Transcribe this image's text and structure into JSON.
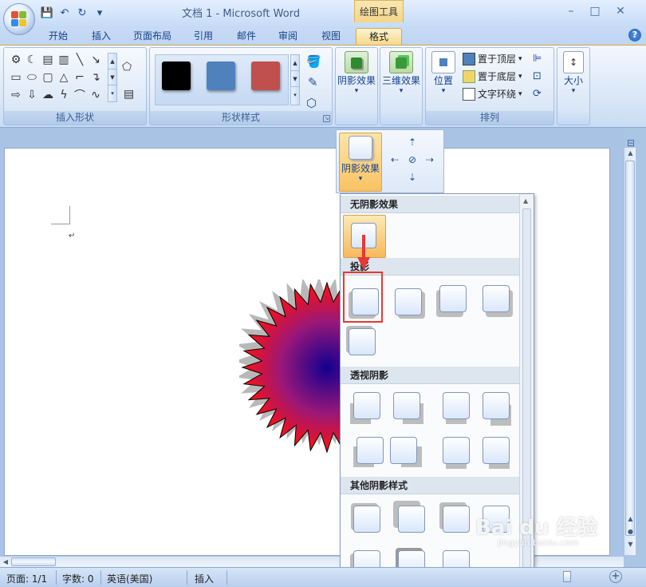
{
  "window": {
    "title": "文档 1 - Microsoft Word",
    "context_tab_group": "绘图工具",
    "controls": {
      "minimize": "–",
      "maximize": "□",
      "close": "✕"
    }
  },
  "quick_access": {
    "save": "💾",
    "undo": "↶",
    "redo": "↻",
    "more": "▾"
  },
  "tabs": [
    {
      "label": "开始"
    },
    {
      "label": "插入"
    },
    {
      "label": "页面布局"
    },
    {
      "label": "引用"
    },
    {
      "label": "邮件"
    },
    {
      "label": "审阅"
    },
    {
      "label": "视图"
    },
    {
      "label": "格式",
      "active": true
    }
  ],
  "help_label": "?",
  "ribbon": {
    "insert_shapes": {
      "label": "插入形状"
    },
    "shape_styles": {
      "label": "形状样式",
      "swatches": [
        "#000000",
        "#4f81bd",
        "#c0504d"
      ]
    },
    "shadow_effects": {
      "label": "阴影效果",
      "arrow": "▾"
    },
    "effects_3d": {
      "label": "三维效果",
      "arrow": "▾"
    },
    "arrange": {
      "label": "排列",
      "position": "位置",
      "bring_to_front": "置于顶层",
      "send_to_back": "置于底层",
      "text_wrap": "文字环绕"
    },
    "size": {
      "label": "大小"
    }
  },
  "shadow_popup": {
    "label": "阴影效果",
    "arrow": "▾"
  },
  "shadow_menu": {
    "sections": [
      {
        "title": "无阴影效果"
      },
      {
        "title": "投影"
      },
      {
        "title": "透视阴影"
      },
      {
        "title": "其他阴影样式"
      }
    ]
  },
  "status": {
    "page": "页面: 1/1",
    "words": "字数: 0",
    "language": "英语(美国)",
    "mode": "插入"
  },
  "colors": {
    "highlight": "#e53935",
    "menu_selection": "#f7b85a"
  },
  "watermark": {
    "text": "Bai du 经验",
    "subtext": "jingyan.baidu.com"
  }
}
